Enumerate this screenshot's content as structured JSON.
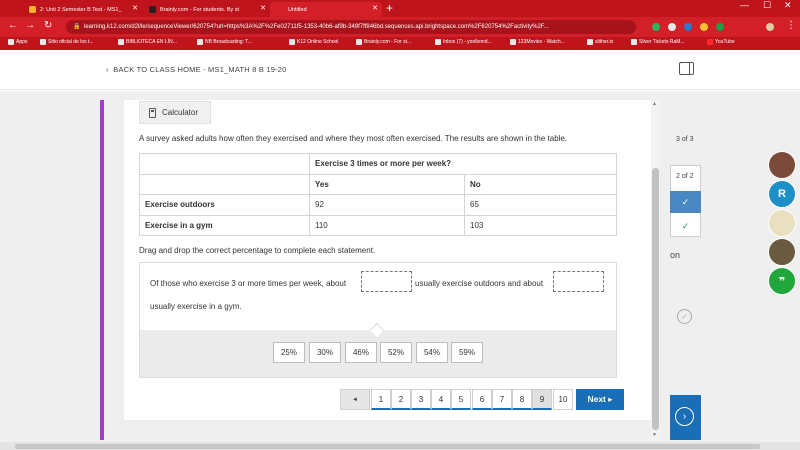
{
  "browser": {
    "tabs": [
      {
        "title": "2: Unit 2 Semester B Test - MS1_"
      },
      {
        "title": "Brainly.com - For students. By st"
      },
      {
        "title": "Untitled"
      }
    ],
    "url": "learning.k12.com/d2l/le/sequenceViewer/620754?url=https%3A%2F%2Fe02711f5-1353-40b6-af9b-349f7ff846bd.sequences.api.brightspace.com%2F620754%2Factivity%2F...",
    "bookmarks": [
      {
        "label": "Apps"
      },
      {
        "label": "Sitio oficial de los t..."
      },
      {
        "label": "BIBLIOTECA EN LÍN..."
      },
      {
        "label": "NB Broadcasting: T..."
      },
      {
        "label": "K12 Online School"
      },
      {
        "label": "Brainly.com - For st..."
      },
      {
        "label": "Inbox (7) - yoelbond..."
      },
      {
        "label": "123Movies - Watch..."
      },
      {
        "label": "slither.io"
      },
      {
        "label": "Silver Tickets RaM..."
      },
      {
        "label": "YouTube"
      }
    ]
  },
  "header": {
    "back_link": "BACK TO CLASS HOME - MS1_MATH 8 B 19-20"
  },
  "main": {
    "calculator_label": "Calculator",
    "question": "A survey asked adults how often they exercised and where they most often exercised. The results are shown in the table.",
    "table": {
      "header": "Exercise 3 times or more per week?",
      "columns": [
        "Yes",
        "No"
      ],
      "rows": [
        {
          "label": "Exercise outdoors",
          "yes": "92",
          "no": "65"
        },
        {
          "label": "Exercise in a gym",
          "yes": "110",
          "no": "103"
        }
      ]
    },
    "instruction": "Drag and drop the correct percentage to complete each statement.",
    "statement": {
      "part1": "Of those who exercise 3 or more times per week, about",
      "part2": "usually exercise outdoors and about",
      "part3": "usually exercise in a gym."
    },
    "choices": [
      "25%",
      "30%",
      "46%",
      "52%",
      "54%",
      "59%"
    ]
  },
  "pager": {
    "prev": "◄",
    "pages": [
      "1",
      "2",
      "3",
      "4",
      "5",
      "6",
      "7",
      "8",
      "9",
      "10"
    ],
    "current_page": "9",
    "next_label": "Next ▸"
  },
  "right_panel": {
    "count": "3 of 3",
    "sub_count": "2 of 2",
    "partial_text": "on",
    "check": "✓"
  },
  "avatars": [
    {
      "initial": "",
      "color": "#7a4a3a"
    },
    {
      "initial": "R",
      "color": "#1c8fc7"
    },
    {
      "initial": "",
      "color": "#e8e0c0"
    },
    {
      "initial": "",
      "color": "#6a5a40"
    },
    {
      "initial": "❞",
      "color": "#21a63b"
    }
  ]
}
